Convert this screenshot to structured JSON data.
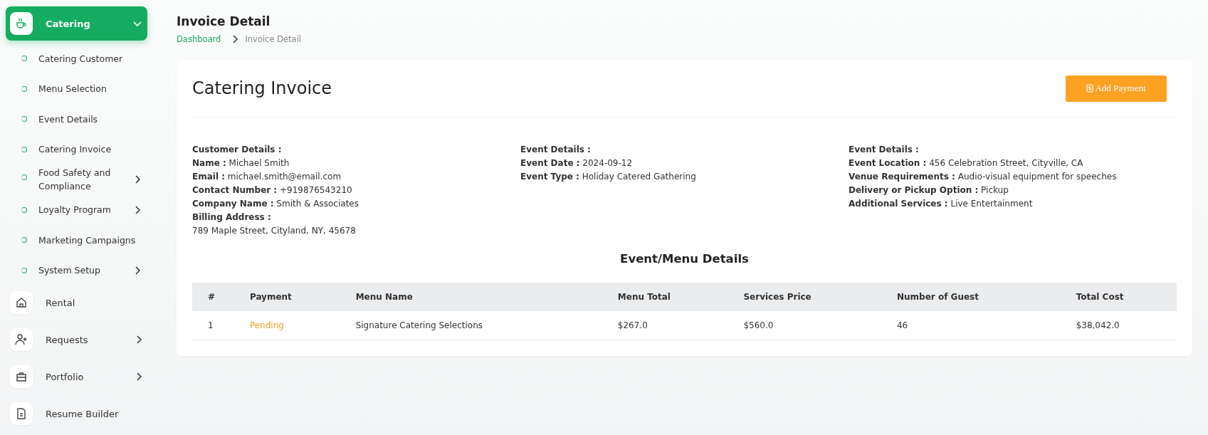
{
  "sidebar": {
    "items": [
      {
        "label": "Catering",
        "kind": "cup",
        "selected": true,
        "expanded": true,
        "children": [
          {
            "label": "Catering Customer",
            "has_submenu": false
          },
          {
            "label": "Menu Selection",
            "has_submenu": false
          },
          {
            "label": "Event Details",
            "has_submenu": false
          },
          {
            "label": "Catering Invoice",
            "has_submenu": false
          },
          {
            "label": "Food Safety and Compliance",
            "has_submenu": true
          },
          {
            "label": "Loyalty Program",
            "has_submenu": true
          },
          {
            "label": "Marketing Campaigns",
            "has_submenu": false
          },
          {
            "label": "System Setup",
            "has_submenu": true
          }
        ]
      },
      {
        "label": "Rental",
        "kind": "home",
        "selected": false
      },
      {
        "label": "Requests",
        "kind": "user-plus",
        "selected": false,
        "expanded": false
      },
      {
        "label": "Portfolio",
        "kind": "briefcase",
        "selected": false,
        "expanded": false
      },
      {
        "label": "Resume Builder",
        "kind": "document",
        "selected": false
      }
    ]
  },
  "page": {
    "title": "Invoice Detail",
    "breadcrumb": [
      "Dashboard",
      "Invoice Detail"
    ]
  },
  "invoice": {
    "title": "Catering Invoice",
    "action_button": "Add Payment",
    "columns": [
      {
        "heading": "Customer Details :",
        "lines": [
          "**Name :** Michael Smith",
          "**Email :** michael.smith@email.com",
          "**Contact Number :** +919876543210",
          "**Company Name :** Smith & Associates",
          "**Billing Address :**",
          "789 Maple Street, Cityland, NY, 45678"
        ]
      },
      {
        "heading": "Event Details :",
        "lines": [
          "**Event Date :** 2024-09-12",
          "**Event Type :** Holiday Catered Gathering"
        ]
      },
      {
        "heading": "Event Details :",
        "lines": [
          "**Event Location :** 456 Celebration Street, Cityville, CA",
          "**Venue Requirements :** Audio-visual equipment for speeches",
          "**Delivery or Pickup Option :** Pickup",
          "**Additional Services :** Live Entertainment"
        ]
      }
    ],
    "table_title": "Event/Menu Details",
    "table": {
      "columns": [
        "#",
        "Payment",
        "Menu Name",
        "Menu Total",
        "Services Price",
        "Number of Guest",
        "Total Cost"
      ],
      "rows": [
        {
          "number": "1",
          "payment": {
            "text": "Pending",
            "kind": "pending"
          },
          "menu_name": "Signature Catering Selections",
          "menu_total": "$267.0",
          "services_price": "$560.0",
          "guests": "46",
          "total_cost": "$38,042.0"
        }
      ]
    }
  }
}
